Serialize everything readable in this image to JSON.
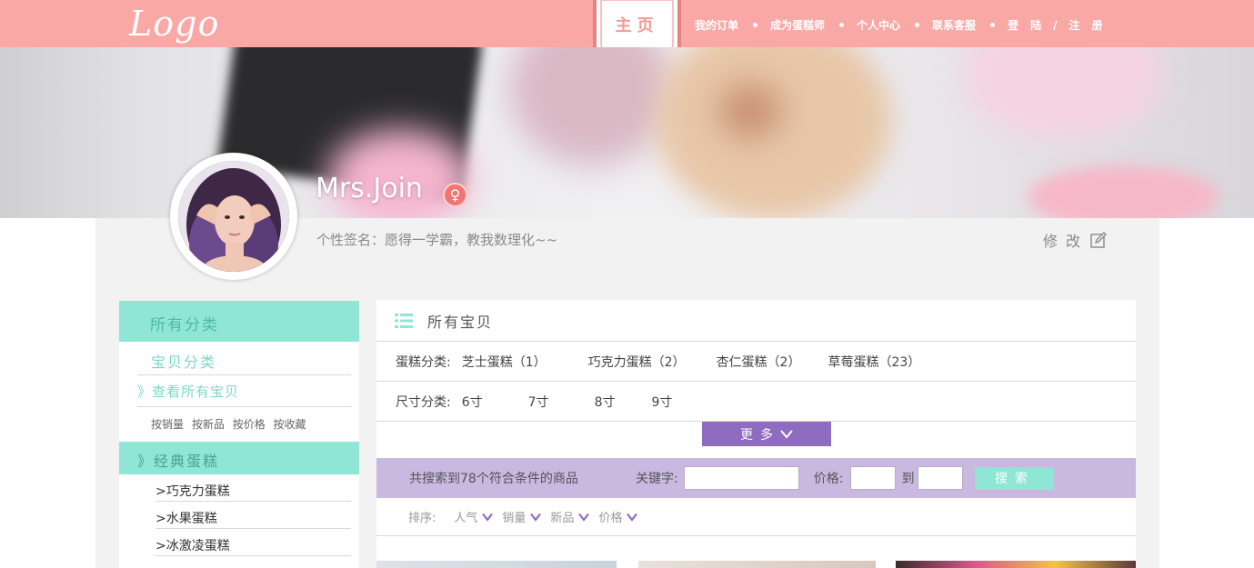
{
  "header": {
    "logo": "Logo",
    "home": "主页",
    "nav": [
      "我的订单",
      "成为蛋糕师",
      "个人中心",
      "联系客服"
    ],
    "login": "登陆/注册"
  },
  "profile": {
    "username": "Mrs.Join",
    "gender_symbol": "♀",
    "signature": "个性签名：愿得一学霸，教我数理化~~",
    "edit_label": "修改"
  },
  "sidebar": {
    "all_categories": "所有分类",
    "product_categories": "宝贝分类",
    "view_all": "》查看所有宝贝",
    "sort_links": [
      "按销量",
      "按新品",
      "按价格",
      "按收藏"
    ],
    "classic_cakes": "》经典蛋糕",
    "cakes": [
      ">巧克力蛋糕",
      ">水果蛋糕",
      ">冰激凌蛋糕"
    ]
  },
  "main": {
    "title": "所有宝贝",
    "cake_category_label": "蛋糕分类:",
    "cake_categories": [
      "芝士蛋糕（1）",
      "巧克力蛋糕（2）",
      "杏仁蛋糕（2）",
      "草莓蛋糕（23）"
    ],
    "size_label": "尺寸分类:",
    "sizes": [
      "6寸",
      "7寸",
      "8寸",
      "9寸"
    ],
    "more": "更多",
    "result_text": "共搜索到78个符合条件的商品",
    "keyword_label": "关键字:",
    "keyword_value": "",
    "price_label": "价格:",
    "price_from": "",
    "to_label": "到",
    "price_to": "",
    "search_button": "搜索",
    "sort_label": "排序:",
    "sort_options": [
      "人气",
      "销量",
      "新品",
      "价格"
    ]
  },
  "colors": {
    "header_pink": "#f9a8a6",
    "mint": "#8fe6d4",
    "purple": "#8f6cc0",
    "lavender": "#c9b8e0",
    "sort_arrow": "#8f6cc0"
  }
}
